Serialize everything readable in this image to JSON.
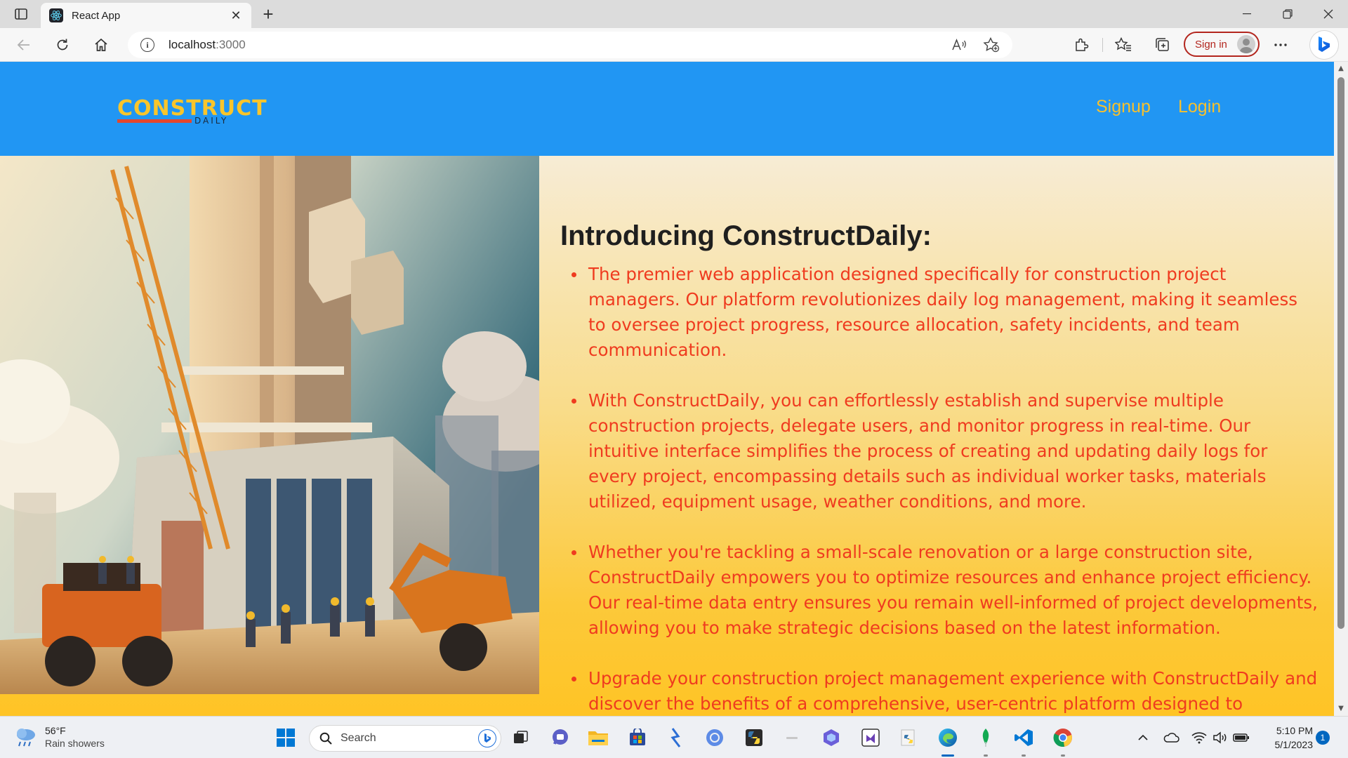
{
  "browser": {
    "tab_title": "React App",
    "address_host": "localhost",
    "address_port": ":3000",
    "signin_label": "Sign in"
  },
  "site": {
    "logo_main": "CONSTRUCT",
    "logo_sub": "DAILY",
    "nav": {
      "signup": "Signup",
      "login": "Login"
    },
    "hero": {
      "title": "Introducing ConstructDaily:",
      "points": [
        "The premier web application designed specifically for construction project managers. Our platform revolutionizes daily log management, making it seamless to oversee project progress, resource allocation, safety incidents, and team communication.",
        "With ConstructDaily, you can effortlessly establish and supervise multiple construction projects, delegate users, and monitor progress in real-time. Our intuitive interface simplifies the process of creating and updating daily logs for every project, encompassing details such as individual worker tasks, materials utilized, equipment usage, weather conditions, and more.",
        "Whether you're tackling a small-scale renovation or a large construction site, ConstructDaily empowers you to optimize resources and enhance project efficiency. Our real-time data entry ensures you remain well-informed of project developments, allowing you to make strategic decisions based on the latest information.",
        "Upgrade your construction project management experience with ConstructDaily and discover the benefits of a comprehensive, user-centric platform designed to streamline your operations."
      ]
    },
    "colors": {
      "header_bg": "#2196f3",
      "nav_link": "#f7c02d",
      "point_text": "#ef3b1f"
    }
  },
  "taskbar": {
    "weather_temp": "56°F",
    "weather_desc": "Rain showers",
    "search_label": "Search",
    "time": "5:10 PM",
    "date": "5/1/2023",
    "notification_count": "1"
  }
}
